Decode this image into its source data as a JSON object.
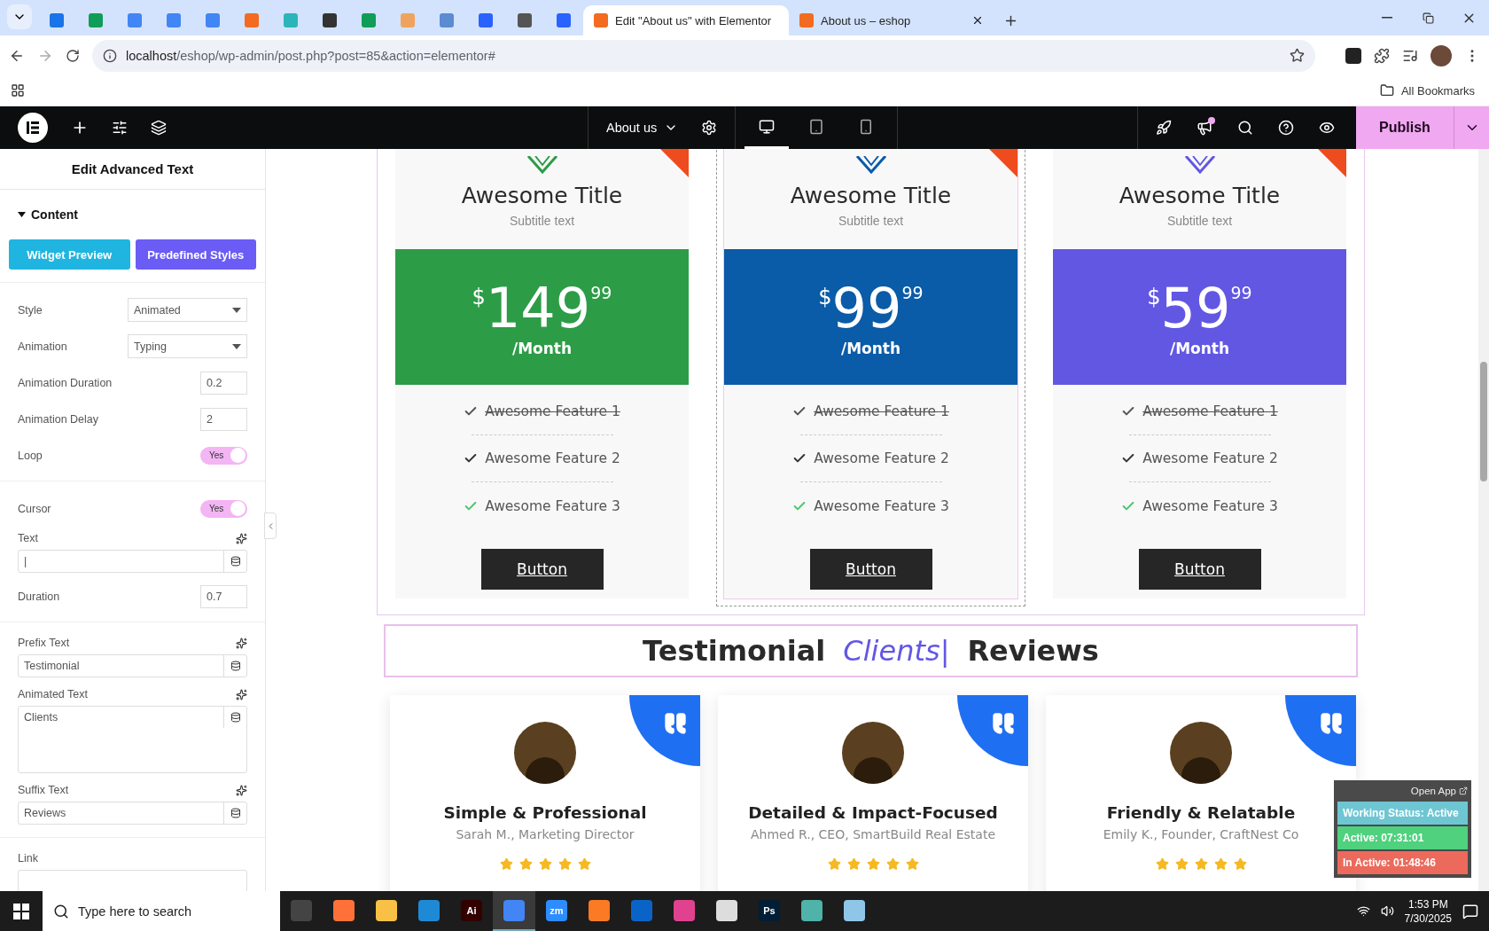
{
  "browser": {
    "tabs": [
      {
        "color": "#1a73e8",
        "selected": false
      },
      {
        "color": "#0f9d58",
        "selected": false
      },
      {
        "color": "#4285f4",
        "selected": false
      },
      {
        "color": "#4285f4",
        "selected": false
      },
      {
        "color": "#4285f4",
        "selected": false
      },
      {
        "color": "#f26b21",
        "selected": false
      },
      {
        "color": "#2bb5b9",
        "selected": false
      },
      {
        "color": "#333333",
        "selected": false
      },
      {
        "color": "#0f9d58",
        "selected": false
      },
      {
        "color": "#f0a35e",
        "selected": false
      },
      {
        "color": "#5b8bd1",
        "selected": false
      },
      {
        "color": "#2962ff",
        "selected": false
      },
      {
        "color": "#555555",
        "selected": false
      },
      {
        "color": "#2962ff",
        "selected": false
      },
      {
        "label": "Edit \"About us\" with Elementor",
        "color": "#f26b21",
        "selected": true
      },
      {
        "label": "About us – eshop",
        "color": "#f26b21",
        "selected": false
      }
    ],
    "url_host": "localhost",
    "url_path": "/eshop/wp-admin/post.php?post=85&action=elementor#",
    "bookmarks": "All Bookmarks"
  },
  "editor_bar": {
    "page": "About us",
    "devices": [
      {
        "selected": true
      },
      {
        "selected": false
      },
      {
        "selected": false
      }
    ],
    "publish": "Publish"
  },
  "panel": {
    "title": "Edit Advanced Text",
    "section": "Content",
    "buttons": [
      {
        "label": "Widget Preview",
        "color": "#1fb5e0"
      },
      {
        "label": "Predefined Styles",
        "color": "#6a5cf5"
      }
    ],
    "groups": [
      [
        {
          "kind": "select",
          "label": "Style",
          "value": "Animated"
        },
        {
          "kind": "select",
          "label": "Animation",
          "value": "Typing"
        },
        {
          "kind": "number",
          "label": "Animation Duration",
          "value": "0.2"
        },
        {
          "kind": "number",
          "label": "Animation Delay",
          "value": "2"
        },
        {
          "kind": "toggle",
          "label": "Loop",
          "value": "Yes",
          "on": true
        }
      ],
      [
        {
          "kind": "toggle",
          "label": "Cursor",
          "value": "Yes",
          "on": true
        },
        {
          "kind": "text",
          "label": "Text",
          "value": "|"
        },
        {
          "kind": "number",
          "label": "Duration",
          "value": "0.7"
        }
      ],
      [
        {
          "kind": "text",
          "label": "Prefix Text",
          "value": "Testimonial"
        },
        {
          "kind": "textarea",
          "label": "Animated Text",
          "value": "Clients"
        },
        {
          "kind": "text",
          "label": "Suffix Text",
          "value": "Reviews"
        }
      ],
      [
        {
          "kind": "link",
          "label": "Link"
        }
      ]
    ]
  },
  "pricing": [
    {
      "title": "Awesome Title",
      "subtitle": "Subtitle text",
      "currency": "$",
      "amount": "149",
      "cents": "99",
      "period": "/Month",
      "color": "#2d9c47",
      "selected": false,
      "features": [
        {
          "text": "Awesome Feature 1",
          "struck": true,
          "color": "#555555"
        },
        {
          "text": "Awesome Feature 2",
          "struck": false,
          "color": "#333333"
        },
        {
          "text": "Awesome Feature 3",
          "struck": false,
          "color": "#4cc76a"
        }
      ],
      "button": "Button"
    },
    {
      "title": "Awesome Title",
      "subtitle": "Subtitle text",
      "currency": "$",
      "amount": "99",
      "cents": "99",
      "period": "/Month",
      "color": "#0a5ba8",
      "selected": true,
      "features": [
        {
          "text": "Awesome Feature 1",
          "struck": true,
          "color": "#555555"
        },
        {
          "text": "Awesome Feature 2",
          "struck": false,
          "color": "#333333"
        },
        {
          "text": "Awesome Feature 3",
          "struck": false,
          "color": "#4cc76a"
        }
      ],
      "button": "Button"
    },
    {
      "title": "Awesome Title",
      "subtitle": "Subtitle text",
      "currency": "$",
      "amount": "59",
      "cents": "99",
      "period": "/Month",
      "color": "#6257e3",
      "selected": false,
      "features": [
        {
          "text": "Awesome Feature 1",
          "struck": true,
          "color": "#555555"
        },
        {
          "text": "Awesome Feature 2",
          "struck": false,
          "color": "#333333"
        },
        {
          "text": "Awesome Feature 3",
          "struck": false,
          "color": "#4cc76a"
        }
      ],
      "button": "Button"
    }
  ],
  "heading": {
    "prefix": "Testimonial",
    "animated": "Clients",
    "cursor": "|",
    "suffix": "Reviews"
  },
  "testimonials": [
    {
      "title": "Simple & Professional",
      "author": "Sarah M., Marketing Director",
      "stars": 5
    },
    {
      "title": "Detailed & Impact-Focused",
      "author": "Ahmed R., CEO, SmartBuild Real Estate",
      "stars": 5
    },
    {
      "title": "Friendly & Relatable",
      "author": "Emily K., Founder, CraftNest Co",
      "stars": 5
    }
  ],
  "tracker": {
    "open_app": "Open App",
    "rows": [
      {
        "text": "Working Status: Active",
        "color": "#6ec6d3"
      },
      {
        "text": "Active: 07:31:01",
        "color": "#4fd17e"
      },
      {
        "text": "In Active: 01:48:46",
        "color": "#ec6a5c"
      }
    ]
  },
  "taskbar": {
    "search_placeholder": "Type here to search",
    "apps": [
      {
        "color": "#444444",
        "selected": false
      },
      {
        "color": "#ff7139",
        "selected": false
      },
      {
        "color": "#f8c146",
        "selected": false
      },
      {
        "color": "#1e8ad6",
        "selected": false
      },
      {
        "label": "Ai",
        "color": "#330000",
        "selected": false
      },
      {
        "color": "#4285f4",
        "selected": true
      },
      {
        "label": "zm",
        "color": "#2d8cff",
        "selected": false
      },
      {
        "color": "#fb7a24",
        "selected": false
      },
      {
        "color": "#0a64c8",
        "selected": false
      },
      {
        "color": "#e0428f",
        "selected": false
      },
      {
        "color": "#dddddd",
        "selected": false
      },
      {
        "label": "Ps",
        "color": "#001e36",
        "selected": false
      },
      {
        "color": "#4fb3a9",
        "selected": false
      },
      {
        "color": "#8fc6e8",
        "selected": false
      }
    ],
    "time": "1:53 PM",
    "date": "7/30/2025"
  }
}
